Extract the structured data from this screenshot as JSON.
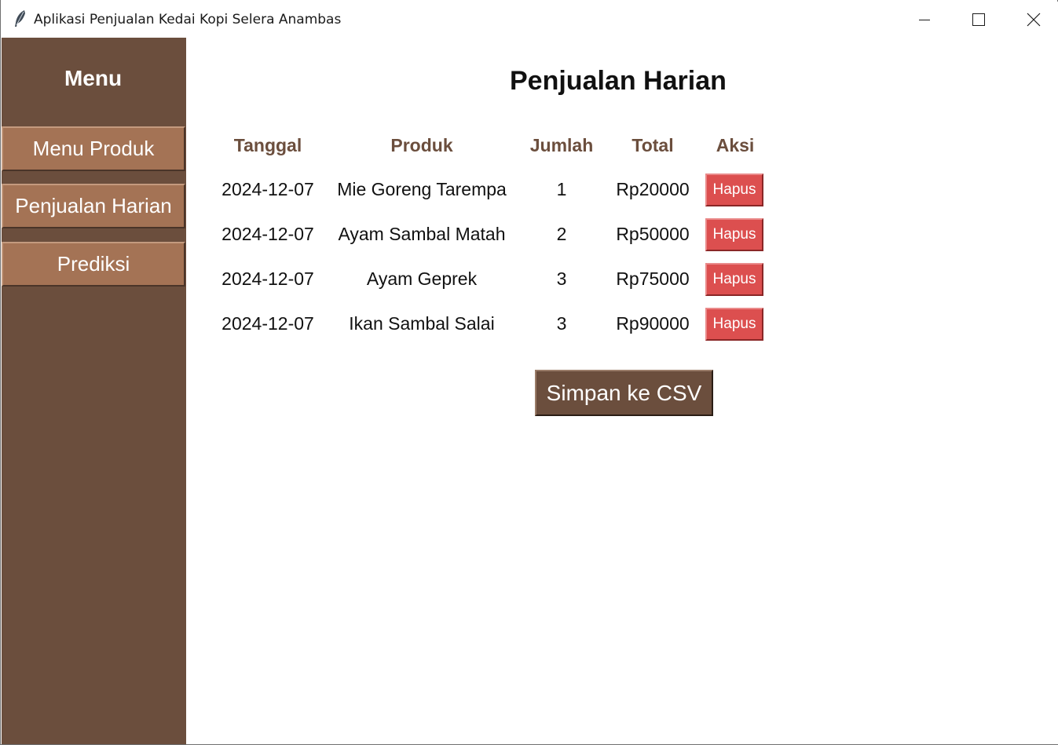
{
  "window": {
    "title": "Aplikasi Penjualan Kedai Kopi Selera Anambas",
    "icon": "feather-icon",
    "controls": [
      "minimize-icon",
      "maximize-icon",
      "close-icon"
    ]
  },
  "sidebar": {
    "title": "Menu",
    "items": [
      {
        "label": "Menu Produk"
      },
      {
        "label": "Penjualan Harian"
      },
      {
        "label": "Prediksi"
      }
    ]
  },
  "main": {
    "title": "Penjualan Harian",
    "columns": [
      "Tanggal",
      "Produk",
      "Jumlah",
      "Total",
      "Aksi"
    ],
    "rows": [
      {
        "tanggal": "2024-12-07",
        "produk": "Mie Goreng Tarempa",
        "jumlah": "1",
        "total": "Rp20000",
        "aksi": "Hapus"
      },
      {
        "tanggal": "2024-12-07",
        "produk": "Ayam Sambal Matah",
        "jumlah": "2",
        "total": "Rp50000",
        "aksi": "Hapus"
      },
      {
        "tanggal": "2024-12-07",
        "produk": "Ayam Geprek",
        "jumlah": "3",
        "total": "Rp75000",
        "aksi": "Hapus"
      },
      {
        "tanggal": "2024-12-07",
        "produk": "Ikan Sambal Salai",
        "jumlah": "3",
        "total": "Rp90000",
        "aksi": "Hapus"
      }
    ],
    "save_label": "Simpan ke CSV"
  },
  "colors": {
    "sidebar_bg": "#6b4e3d",
    "sidebar_button": "#a47355",
    "header_text": "#6b4e3d",
    "delete_button": "#dc4f4f",
    "save_button": "#6b4e3d"
  }
}
